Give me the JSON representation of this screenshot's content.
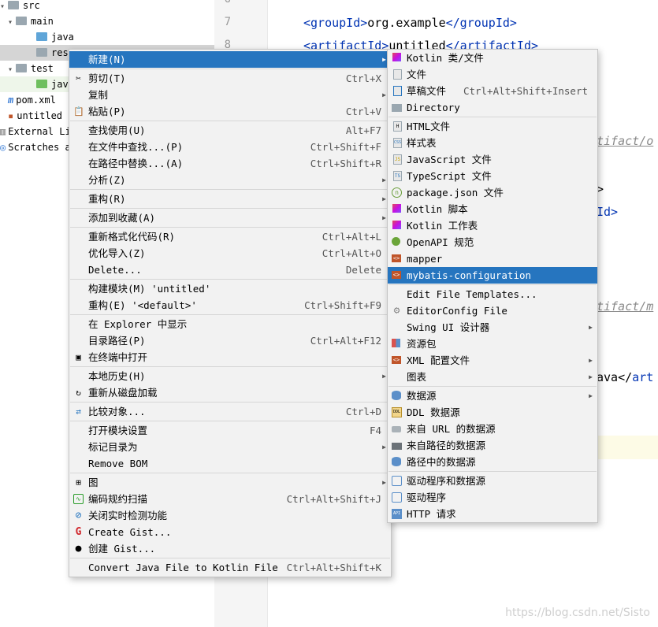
{
  "tree": {
    "items": [
      {
        "label": "src",
        "arrow": "▾"
      },
      {
        "label": "main",
        "arrow": "▾"
      },
      {
        "label": "java",
        "arrow": ""
      },
      {
        "label": "res",
        "arrow": ""
      },
      {
        "label": "test",
        "arrow": "▾"
      },
      {
        "label": "jav",
        "arrow": ""
      },
      {
        "label": "pom.xml",
        "arrow": ""
      },
      {
        "label": "untitled",
        "arrow": ""
      },
      {
        "label": "External Li",
        "arrow": ""
      },
      {
        "label": "Scratches a",
        "arrow": ""
      }
    ]
  },
  "editor": {
    "line_numbers": [
      "6",
      "7",
      "8"
    ],
    "lines": [
      {
        "open": "<groupId>",
        "text": "org.example",
        "close": "</groupId>"
      },
      {
        "open": "<artifactId>",
        "text": "untitled",
        "close": "</artifactId>"
      }
    ],
    "fragments": [
      "tifact/o",
      ">",
      "Id>",
      "tifact/m",
      "ava</",
      "art"
    ]
  },
  "main_menu": {
    "items": [
      {
        "label": "新建(N)",
        "shortcut": "",
        "submenu": true,
        "icon": ""
      },
      {
        "label": "剪切(T)",
        "shortcut": "Ctrl+X",
        "submenu": false,
        "icon": "✂"
      },
      {
        "label": "复制",
        "shortcut": "",
        "submenu": true,
        "icon": ""
      },
      {
        "label": "粘贴(P)",
        "shortcut": "Ctrl+V",
        "submenu": false,
        "icon": "📋"
      },
      {
        "label": "查找使用(U)",
        "shortcut": "Alt+F7",
        "submenu": false,
        "icon": ""
      },
      {
        "label": "在文件中查找...(P)",
        "shortcut": "Ctrl+Shift+F",
        "submenu": false,
        "icon": ""
      },
      {
        "label": "在路径中替换...(A)",
        "shortcut": "Ctrl+Shift+R",
        "submenu": false,
        "icon": ""
      },
      {
        "label": "分析(Z)",
        "shortcut": "",
        "submenu": true,
        "icon": ""
      },
      {
        "label": "重构(R)",
        "shortcut": "",
        "submenu": true,
        "icon": ""
      },
      {
        "label": "添加到收藏(A)",
        "shortcut": "",
        "submenu": true,
        "icon": ""
      },
      {
        "label": "重新格式化代码(R)",
        "shortcut": "Ctrl+Alt+L",
        "submenu": false,
        "icon": ""
      },
      {
        "label": "优化导入(Z)",
        "shortcut": "Ctrl+Alt+O",
        "submenu": false,
        "icon": ""
      },
      {
        "label": "Delete...",
        "shortcut": "Delete",
        "submenu": false,
        "icon": ""
      },
      {
        "label": "构建模块(M) 'untitled'",
        "shortcut": "",
        "submenu": false,
        "icon": ""
      },
      {
        "label": "重构(E) '<default>'",
        "shortcut": "Ctrl+Shift+F9",
        "submenu": false,
        "icon": ""
      },
      {
        "label": "在 Explorer 中显示",
        "shortcut": "",
        "submenu": false,
        "icon": ""
      },
      {
        "label": "目录路径(P)",
        "shortcut": "Ctrl+Alt+F12",
        "submenu": false,
        "icon": ""
      },
      {
        "label": "在终端中打开",
        "shortcut": "",
        "submenu": false,
        "icon": "▣"
      },
      {
        "label": "本地历史(H)",
        "shortcut": "",
        "submenu": true,
        "icon": ""
      },
      {
        "label": "重新从磁盘加载",
        "shortcut": "",
        "submenu": false,
        "icon": "↻"
      },
      {
        "label": "比较对象...",
        "shortcut": "Ctrl+D",
        "submenu": false,
        "icon": "⇄"
      },
      {
        "label": "打开模块设置",
        "shortcut": "F4",
        "submenu": false,
        "icon": ""
      },
      {
        "label": "标记目录为",
        "shortcut": "",
        "submenu": true,
        "icon": ""
      },
      {
        "label": "Remove BOM",
        "shortcut": "",
        "submenu": false,
        "icon": ""
      },
      {
        "label": "图",
        "shortcut": "",
        "submenu": true,
        "icon": "⊞"
      },
      {
        "label": "编码规约扫描",
        "shortcut": "Ctrl+Alt+Shift+J",
        "submenu": false,
        "icon": "∿"
      },
      {
        "label": "关闭实时检测功能",
        "shortcut": "",
        "submenu": false,
        "icon": "⊘"
      },
      {
        "label": "Create Gist...",
        "shortcut": "",
        "submenu": false,
        "icon": "G"
      },
      {
        "label": "创建 Gist...",
        "shortcut": "",
        "submenu": false,
        "icon": "●"
      },
      {
        "label": "Convert Java File to Kotlin File",
        "shortcut": "Ctrl+Alt+Shift+K",
        "submenu": false,
        "icon": ""
      }
    ]
  },
  "sub_menu": {
    "items": [
      {
        "label": "Kotlin 类/文件",
        "shortcut": "",
        "submenu": false,
        "icon": "kotlin-icon"
      },
      {
        "label": "文件",
        "shortcut": "",
        "submenu": false,
        "icon": "file-icon"
      },
      {
        "label": "草稿文件",
        "shortcut": "Ctrl+Alt+Shift+Insert",
        "submenu": false,
        "icon": "scratch-file-icon"
      },
      {
        "label": "Directory",
        "shortcut": "",
        "submenu": false,
        "icon": "folder-icon"
      },
      {
        "label": "HTML文件",
        "shortcut": "",
        "submenu": false,
        "icon": "html-icon"
      },
      {
        "label": "样式表",
        "shortcut": "",
        "submenu": false,
        "icon": "css-icon"
      },
      {
        "label": "JavaScript 文件",
        "shortcut": "",
        "submenu": false,
        "icon": "js-icon"
      },
      {
        "label": "TypeScript 文件",
        "shortcut": "",
        "submenu": false,
        "icon": "ts-icon"
      },
      {
        "label": "package.json 文件",
        "shortcut": "",
        "submenu": false,
        "icon": "npm-icon"
      },
      {
        "label": "Kotlin 脚本",
        "shortcut": "",
        "submenu": false,
        "icon": "kotlin-icon"
      },
      {
        "label": "Kotlin 工作表",
        "shortcut": "",
        "submenu": false,
        "icon": "kotlin-icon"
      },
      {
        "label": "OpenAPI 规范",
        "shortcut": "",
        "submenu": false,
        "icon": "openapi-icon"
      },
      {
        "label": "mapper",
        "shortcut": "",
        "submenu": false,
        "icon": "xml-template-icon"
      },
      {
        "label": "mybatis-configuration",
        "shortcut": "",
        "submenu": false,
        "icon": "xml-template-icon"
      },
      {
        "label": "Edit File Templates...",
        "shortcut": "",
        "submenu": false,
        "icon": ""
      },
      {
        "label": "EditorConfig File",
        "shortcut": "",
        "submenu": false,
        "icon": "gear-icon"
      },
      {
        "label": "Swing UI 设计器",
        "shortcut": "",
        "submenu": true,
        "icon": ""
      },
      {
        "label": "资源包",
        "shortcut": "",
        "submenu": false,
        "icon": "resource-bundle-icon"
      },
      {
        "label": "XML 配置文件",
        "shortcut": "",
        "submenu": true,
        "icon": "xml-icon"
      },
      {
        "label": "图表",
        "shortcut": "",
        "submenu": true,
        "icon": ""
      },
      {
        "label": "数据源",
        "shortcut": "",
        "submenu": true,
        "icon": "database-icon"
      },
      {
        "label": "DDL 数据源",
        "shortcut": "",
        "submenu": false,
        "icon": "ddl-icon"
      },
      {
        "label": "来自 URL 的数据源",
        "shortcut": "",
        "submenu": false,
        "icon": "url-icon"
      },
      {
        "label": "来自路径的数据源",
        "shortcut": "",
        "submenu": false,
        "icon": "folder-open-icon"
      },
      {
        "label": "路径中的数据源",
        "shortcut": "",
        "submenu": false,
        "icon": "database-icon"
      },
      {
        "label": "驱动程序和数据源",
        "shortcut": "",
        "submenu": false,
        "icon": "driver-icon"
      },
      {
        "label": "驱动程序",
        "shortcut": "",
        "submenu": false,
        "icon": "driver-icon"
      },
      {
        "label": "HTTP 请求",
        "shortcut": "",
        "submenu": false,
        "icon": "api-icon"
      }
    ]
  },
  "watermark": "https://blog.csdn.net/Sisto",
  "colors": {
    "selection": "#2675bf",
    "menu_bg": "#f2f2f2",
    "xml_tag": "#0033b3"
  }
}
